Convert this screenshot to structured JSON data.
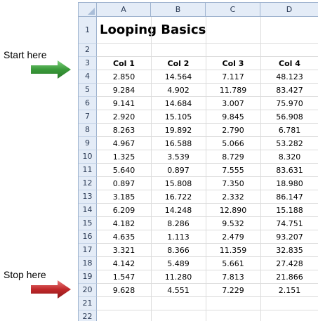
{
  "sheet": {
    "columns": [
      "A",
      "B",
      "C",
      "D"
    ],
    "rows": [
      "1",
      "2",
      "3",
      "4",
      "5",
      "6",
      "7",
      "8",
      "9",
      "10",
      "11",
      "12",
      "13",
      "14",
      "15",
      "16",
      "17",
      "18",
      "19",
      "20",
      "21",
      "22"
    ],
    "title": "Looping Basics",
    "headers": [
      "Col 1",
      "Col 2",
      "Col 3",
      "Col 4"
    ],
    "data": [
      [
        "2.850",
        "14.564",
        "7.117",
        "48.123"
      ],
      [
        "9.284",
        "4.902",
        "11.789",
        "83.427"
      ],
      [
        "9.141",
        "14.684",
        "3.007",
        "75.970"
      ],
      [
        "2.920",
        "15.105",
        "9.845",
        "56.908"
      ],
      [
        "8.263",
        "19.892",
        "2.790",
        "6.781"
      ],
      [
        "4.967",
        "16.588",
        "5.066",
        "53.282"
      ],
      [
        "1.325",
        "3.539",
        "8.729",
        "8.320"
      ],
      [
        "5.640",
        "0.897",
        "7.555",
        "83.631"
      ],
      [
        "0.897",
        "15.808",
        "7.350",
        "18.980"
      ],
      [
        "3.185",
        "16.722",
        "2.332",
        "86.147"
      ],
      [
        "6.209",
        "14.248",
        "12.890",
        "15.188"
      ],
      [
        "4.182",
        "8.286",
        "9.532",
        "74.751"
      ],
      [
        "4.635",
        "1.113",
        "2.479",
        "93.207"
      ],
      [
        "3.321",
        "8.366",
        "11.359",
        "32.835"
      ],
      [
        "4.142",
        "5.489",
        "5.661",
        "27.428"
      ],
      [
        "1.547",
        "11.280",
        "7.813",
        "21.866"
      ],
      [
        "9.628",
        "4.551",
        "7.229",
        "2.151"
      ]
    ]
  },
  "annotations": {
    "start_label": "Start here",
    "stop_label": "Stop here",
    "start_color": "#3a9a3a",
    "stop_color": "#c0282a"
  }
}
